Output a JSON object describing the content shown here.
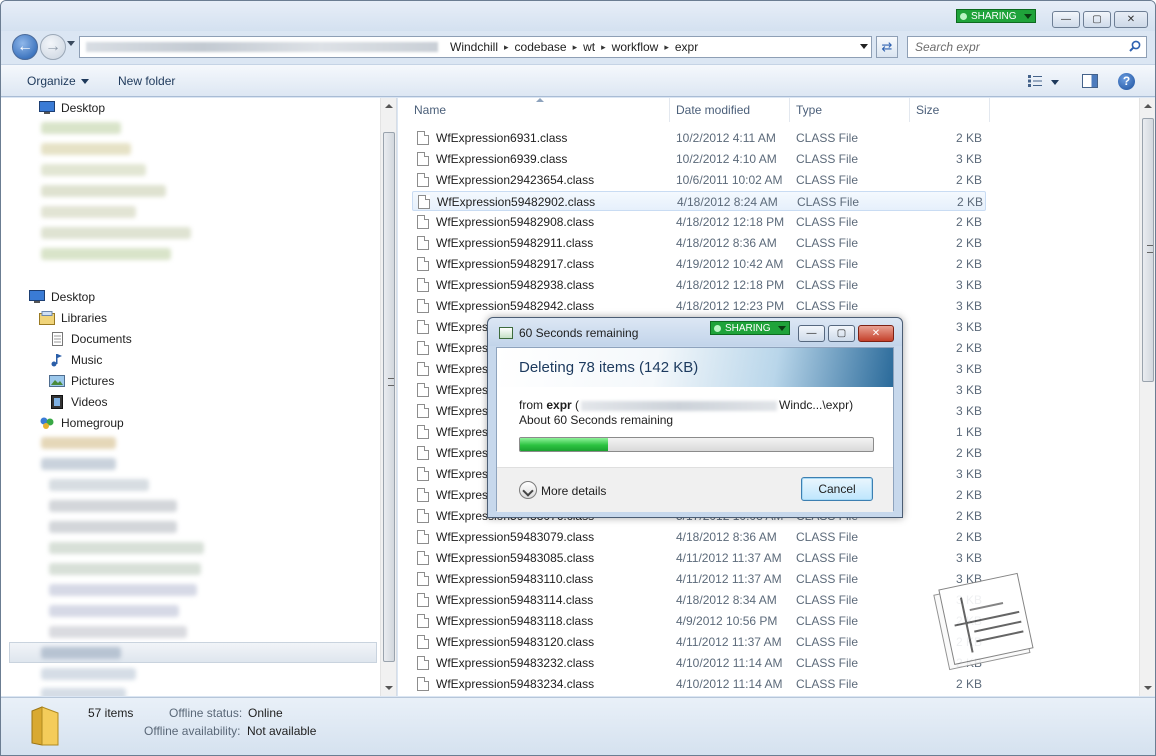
{
  "window": {
    "sharing_label": "SHARING",
    "controls": {
      "minimize": "—",
      "maximize": "▢",
      "close": "✕"
    }
  },
  "address": {
    "crumbs": [
      "Windchill",
      "codebase",
      "wt",
      "workflow",
      "expr"
    ],
    "search_placeholder": "Search expr"
  },
  "toolbar": {
    "organize": "Organize",
    "new_folder": "New folder"
  },
  "nav": {
    "favorites_desktop": "Desktop",
    "desktop": "Desktop",
    "libraries": "Libraries",
    "documents": "Documents",
    "music": "Music",
    "pictures": "Pictures",
    "videos": "Videos",
    "homegroup": "Homegroup"
  },
  "columns": {
    "name": "Name",
    "date": "Date modified",
    "type": "Type",
    "size": "Size"
  },
  "files": [
    {
      "name": "WfExpression6931.class",
      "date": "10/2/2012 4:11 AM",
      "type": "CLASS File",
      "size": "2 KB"
    },
    {
      "name": "WfExpression6939.class",
      "date": "10/2/2012 4:10 AM",
      "type": "CLASS File",
      "size": "3 KB"
    },
    {
      "name": "WfExpression29423654.class",
      "date": "10/6/2011 10:02 AM",
      "type": "CLASS File",
      "size": "2 KB"
    },
    {
      "name": "WfExpression59482902.class",
      "date": "4/18/2012 8:24 AM",
      "type": "CLASS File",
      "size": "2 KB"
    },
    {
      "name": "WfExpression59482908.class",
      "date": "4/18/2012 12:18 PM",
      "type": "CLASS File",
      "size": "2 KB"
    },
    {
      "name": "WfExpression59482911.class",
      "date": "4/18/2012 8:36 AM",
      "type": "CLASS File",
      "size": "2 KB"
    },
    {
      "name": "WfExpression59482917.class",
      "date": "4/19/2012 10:42 AM",
      "type": "CLASS File",
      "size": "2 KB"
    },
    {
      "name": "WfExpression59482938.class",
      "date": "4/18/2012 12:18 PM",
      "type": "CLASS File",
      "size": "3 KB"
    },
    {
      "name": "WfExpression59482942.class",
      "date": "4/18/2012 12:23 PM",
      "type": "CLASS File",
      "size": "3 KB"
    },
    {
      "name": "WfExpress",
      "date": "",
      "type": "",
      "size": "3 KB"
    },
    {
      "name": "WfExpress",
      "date": "",
      "type": "",
      "size": "2 KB"
    },
    {
      "name": "WfExpress",
      "date": "",
      "type": "",
      "size": "3 KB"
    },
    {
      "name": "WfExpress",
      "date": "",
      "type": "",
      "size": "3 KB"
    },
    {
      "name": "WfExpress",
      "date": "",
      "type": "",
      "size": "3 KB"
    },
    {
      "name": "WfExpress",
      "date": "",
      "type": "",
      "size": "1 KB"
    },
    {
      "name": "WfExpress",
      "date": "",
      "type": "",
      "size": "2 KB"
    },
    {
      "name": "WfExpress",
      "date": "",
      "type": "",
      "size": "3 KB"
    },
    {
      "name": "WfExpress",
      "date": "",
      "type": "",
      "size": "2 KB"
    },
    {
      "name": "WfExpression59483076.class",
      "date": "5/17/2012 10:03 AM",
      "type": "CLASS File",
      "size": "2 KB"
    },
    {
      "name": "WfExpression59483079.class",
      "date": "4/18/2012 8:36 AM",
      "type": "CLASS File",
      "size": "2 KB"
    },
    {
      "name": "WfExpression59483085.class",
      "date": "4/11/2012 11:37 AM",
      "type": "CLASS File",
      "size": "3 KB"
    },
    {
      "name": "WfExpression59483110.class",
      "date": "4/11/2012 11:37 AM",
      "type": "CLASS File",
      "size": "3 KB"
    },
    {
      "name": "WfExpression59483114.class",
      "date": "4/18/2012 8:34 AM",
      "type": "CLASS File",
      "size": "3 KB"
    },
    {
      "name": "WfExpression59483118.class",
      "date": "4/9/2012 10:56 PM",
      "type": "CLASS File",
      "size": "2 KB"
    },
    {
      "name": "WfExpression59483120.class",
      "date": "4/11/2012 11:37 AM",
      "type": "CLASS File",
      "size": "2 KB"
    },
    {
      "name": "WfExpression59483232.class",
      "date": "4/10/2012 11:14 AM",
      "type": "CLASS File",
      "size": "2 KB"
    },
    {
      "name": "WfExpression59483234.class",
      "date": "4/10/2012 11:14 AM",
      "type": "CLASS File",
      "size": "2 KB"
    }
  ],
  "status": {
    "count": "57 items",
    "offline_status_label": "Offline status:",
    "offline_status_value": "Online",
    "offline_avail_label": "Offline availability:",
    "offline_avail_value": "Not available"
  },
  "dialog": {
    "caption": "60 Seconds remaining",
    "sharing_label": "SHARING",
    "heading": "Deleting 78 items (142 KB)",
    "from_label": "from",
    "from_folder": "expr",
    "from_path_end": "Windc...\\expr)",
    "remaining": "About 60 Seconds remaining",
    "progress": 0.25,
    "more_details": "More details",
    "cancel": "Cancel"
  }
}
